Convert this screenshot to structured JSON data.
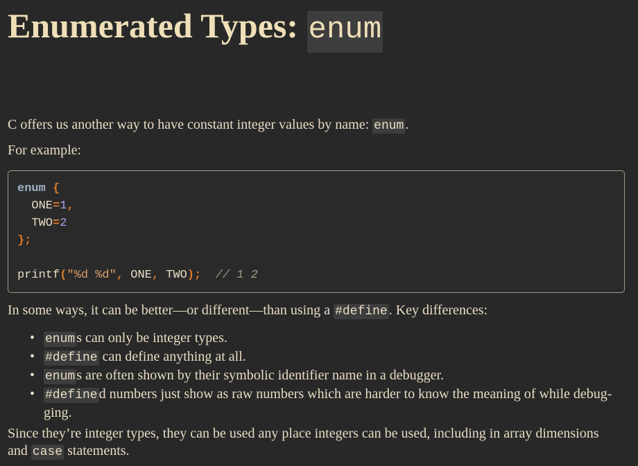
{
  "title": {
    "text": "Enumerated Types: ",
    "code": "enum"
  },
  "intro": {
    "before": "C offers us another way to have constant integer values by name: ",
    "code": "enum",
    "after": "."
  },
  "example_label": "For example:",
  "code_block": {
    "line1": {
      "kw": "enum",
      "brace": "{"
    },
    "line2": {
      "ident": "ONE",
      "eq": "=",
      "num": "1",
      "comma": ","
    },
    "line3": {
      "ident": "TWO",
      "eq": "=",
      "num": "2"
    },
    "line4": {
      "close": "};"
    },
    "line6": {
      "fn": "printf",
      "open": "(",
      "str": "\"%d %d\"",
      "comma1": ",",
      "arg1": "ONE",
      "comma2": ",",
      "arg2": "TWO",
      "close": ");",
      "comment": "// 1 2"
    }
  },
  "comparison": {
    "before": "In some ways, it can be better—or different—than using a ",
    "code": "#define",
    "after": ". Key differences:"
  },
  "bullets": [
    {
      "code": "enum",
      "text": "s can only be integer types."
    },
    {
      "code": "#define",
      "text": " can define anything at all."
    },
    {
      "code": "enum",
      "text": "s are often shown by their symbolic identifier name in a debugger."
    },
    {
      "code": "#define",
      "text": "d numbers just show as raw numbers which are harder to know the meaning of while debug-",
      "text2": "ging."
    }
  ],
  "bullet_glyph": "•",
  "closing": {
    "line1": "Since they’re integer types, they can be used any place integers can be used, including in array dimensions",
    "and": "and ",
    "code": "case",
    "after": " statements."
  }
}
